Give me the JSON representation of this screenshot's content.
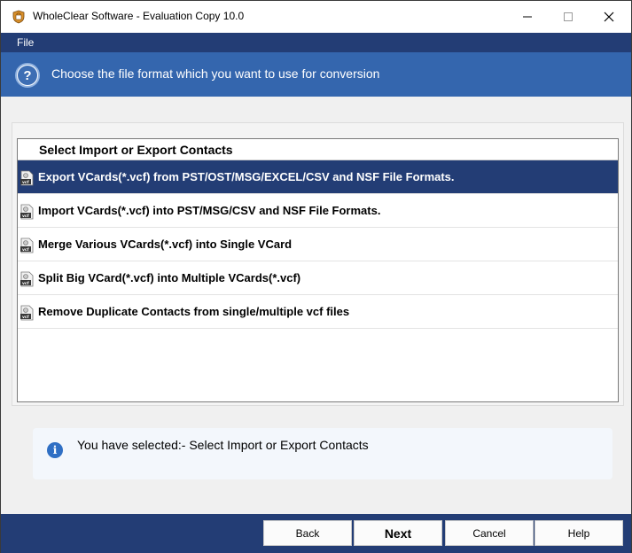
{
  "window": {
    "title": "WholeClear Software - Evaluation Copy 10.0"
  },
  "menu": {
    "file_label": "File"
  },
  "header": {
    "instruction": "Choose the file format which you want to use for conversion"
  },
  "list": {
    "header": "Select Import or Export Contacts",
    "items": [
      {
        "label": "Export VCards(*.vcf) from PST/OST/MSG/EXCEL/CSV and NSF File Formats.",
        "selected": true
      },
      {
        "label": "Import VCards(*.vcf) into PST/MSG/CSV and NSF File Formats.",
        "selected": false
      },
      {
        "label": "Merge Various VCards(*.vcf) into Single VCard",
        "selected": false
      },
      {
        "label": "Split Big VCard(*.vcf) into Multiple VCards(*.vcf)",
        "selected": false
      },
      {
        "label": "Remove Duplicate Contacts from single/multiple vcf files",
        "selected": false
      }
    ]
  },
  "status": {
    "message": "You have selected:- Select Import or Export Contacts"
  },
  "buttons": {
    "back": "Back",
    "next": "Next",
    "cancel": "Cancel",
    "help": "Help"
  },
  "colors": {
    "navy": "#233d75",
    "header_blue": "#3466ae",
    "info_icon": "#2f6fc4"
  },
  "icons": {
    "app": "app-shield-icon",
    "help": "question-icon",
    "item": "vcf-file-icon",
    "info": "info-icon"
  }
}
